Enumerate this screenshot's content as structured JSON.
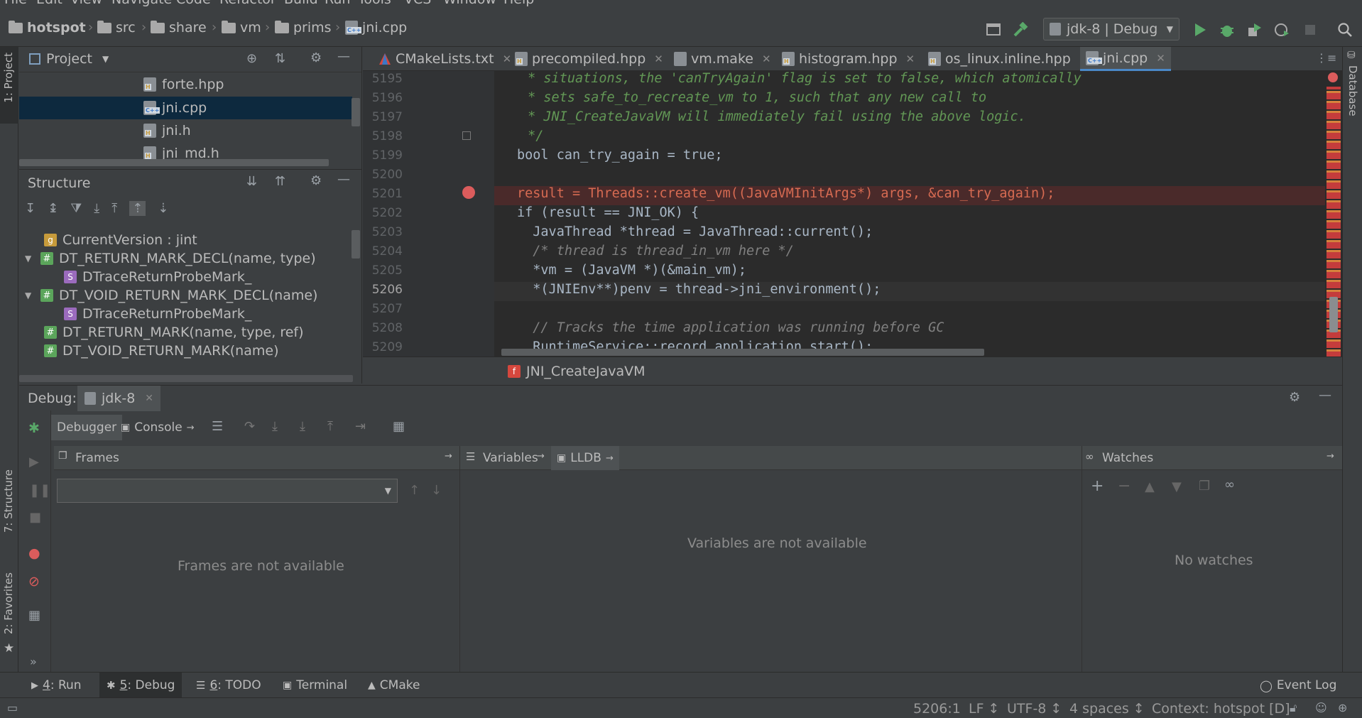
{
  "menu": [
    "File",
    "Edit",
    "View",
    "Navigate",
    "Code",
    "Refactor",
    "Build",
    "Run",
    "Tools",
    "VCS",
    "Window",
    "Help"
  ],
  "breadcrumb": [
    "hotspot",
    "src",
    "share",
    "vm",
    "prims",
    "jni.cpp"
  ],
  "run_config": "jdk-8 | Debug",
  "project": {
    "title": "Project",
    "tab_label": "1: Project",
    "files": [
      "forte.hpp",
      "jni.cpp",
      "jni.h",
      "jni_md.h"
    ]
  },
  "structure": {
    "title": "Structure",
    "tab_label": "7: Structure",
    "items": [
      {
        "label": "CurrentVersion : jint",
        "badge": "g"
      },
      {
        "label": "DT_RETURN_MARK_DECL(name, type)",
        "badge": "#"
      },
      {
        "label": "DTraceReturnProbeMark_",
        "badge": "S"
      },
      {
        "label": "DT_VOID_RETURN_MARK_DECL(name)",
        "badge": "#"
      },
      {
        "label": "DTraceReturnProbeMark_",
        "badge": "S"
      },
      {
        "label": "DT_RETURN_MARK(name, type, ref)",
        "badge": "#"
      },
      {
        "label": "DT_VOID_RETURN_MARK(name)",
        "badge": "#"
      }
    ]
  },
  "favorites_label": "2: Favorites",
  "database_label": "Database",
  "tabs": [
    "CMakeLists.txt",
    "precompiled.hpp",
    "vm.make",
    "histogram.hpp",
    "os_linux.inline.hpp",
    "jni.cpp"
  ],
  "editor": {
    "line_numbers": [
      "5195",
      "5196",
      "5197",
      "5198",
      "5199",
      "5200",
      "5201",
      "5202",
      "5203",
      "5204",
      "5205",
      "5206",
      "5207",
      "5208",
      "5209"
    ],
    "lines": [
      " * situations, the 'canTryAgain' flag is set to false, which atomically",
      " * sets safe_to_recreate_vm to 1, such that any new call to",
      " * JNI_CreateJavaVM will immediately fail using the above logic.",
      " */",
      "bool can_try_again = true;",
      "",
      "result = Threads::create_vm((JavaVMInitArgs*) args, &can_try_again);",
      "if (result == JNI_OK) {",
      "  JavaThread *thread = JavaThread::current();",
      "  /* thread is thread_in_vm here */",
      "  *vm = (JavaVM *)(&main_vm);",
      "  *(JNIEnv**)penv = thread->jni_environment();",
      "",
      "  // Tracks the time application was running before GC",
      "  RuntimeService::record_application_start();"
    ],
    "function_breadcrumb": "JNI_CreateJavaVM"
  },
  "debug": {
    "label": "Debug:",
    "session": "jdk-8",
    "tabs": [
      "Debugger",
      "Console"
    ],
    "frames_title": "Frames",
    "variables_title": "Variables",
    "lldb_title": "LLDB",
    "watches_title": "Watches",
    "frames_empty": "Frames are not available",
    "variables_empty": "Variables are not available",
    "watches_empty": "No watches"
  },
  "bottom_tools": [
    {
      "num": "4",
      "label": ": Run"
    },
    {
      "num": "5",
      "label": ": Debug"
    },
    {
      "num": "6",
      "label": ": TODO"
    },
    {
      "num": "",
      "label": "Terminal"
    },
    {
      "num": "",
      "label": "CMake"
    }
  ],
  "event_log": "Event Log",
  "status": {
    "position": "5206:1",
    "line_sep": "LF ↕",
    "encoding": "UTF-8 ↕",
    "indent": "4 spaces ↕",
    "context": "Context: hotspot [D]"
  },
  "colors": {
    "accent": "#4a88c7",
    "breakpoint": "#db5c5c",
    "run_green": "#59a869"
  }
}
